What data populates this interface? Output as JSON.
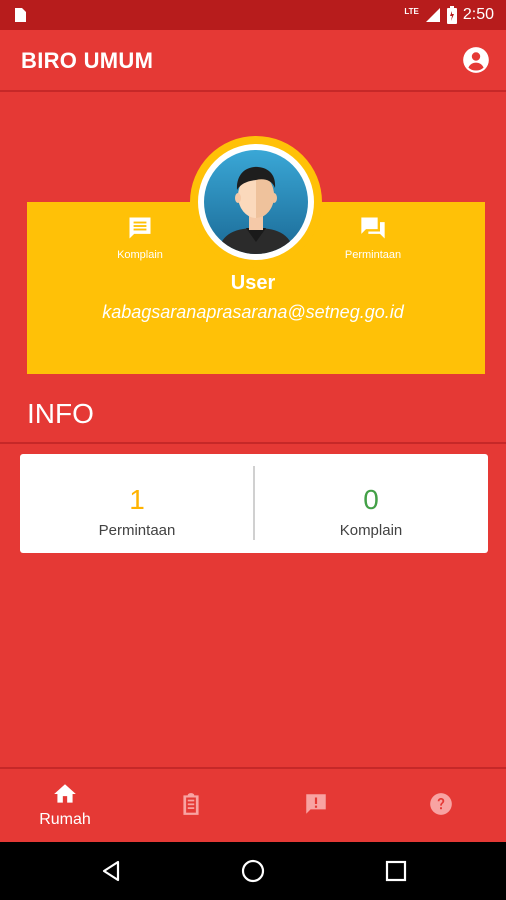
{
  "status_bar": {
    "time": "2:50",
    "network": "LTE",
    "icons": [
      "sim-card-icon",
      "signal-icon",
      "battery-icon"
    ]
  },
  "app_bar": {
    "title": "BIRO UMUM",
    "account_icon": "account-circle-icon"
  },
  "profile": {
    "name": "User",
    "email": "kabagsaranaprasarana@setneg.go.id",
    "actions": [
      {
        "label": "Komplain",
        "icon": "comment-icon"
      },
      {
        "label": "Permintaan",
        "icon": "forum-icon"
      }
    ]
  },
  "info": {
    "title": "INFO",
    "stats": [
      {
        "value": "1",
        "label": "Permintaan",
        "color": "#ffb300"
      },
      {
        "value": "0",
        "label": "Komplain",
        "color": "#43a047"
      }
    ]
  },
  "bottom_nav": {
    "items": [
      {
        "label": "Rumah",
        "icon": "home-icon",
        "active": true
      },
      {
        "label": "",
        "icon": "clipboard-icon",
        "active": false
      },
      {
        "label": "",
        "icon": "feedback-icon",
        "active": false
      },
      {
        "label": "",
        "icon": "help-icon",
        "active": false
      }
    ]
  },
  "colors": {
    "primary": "#e53935",
    "primary_dark": "#b71c1c",
    "accent": "#ffc107"
  }
}
